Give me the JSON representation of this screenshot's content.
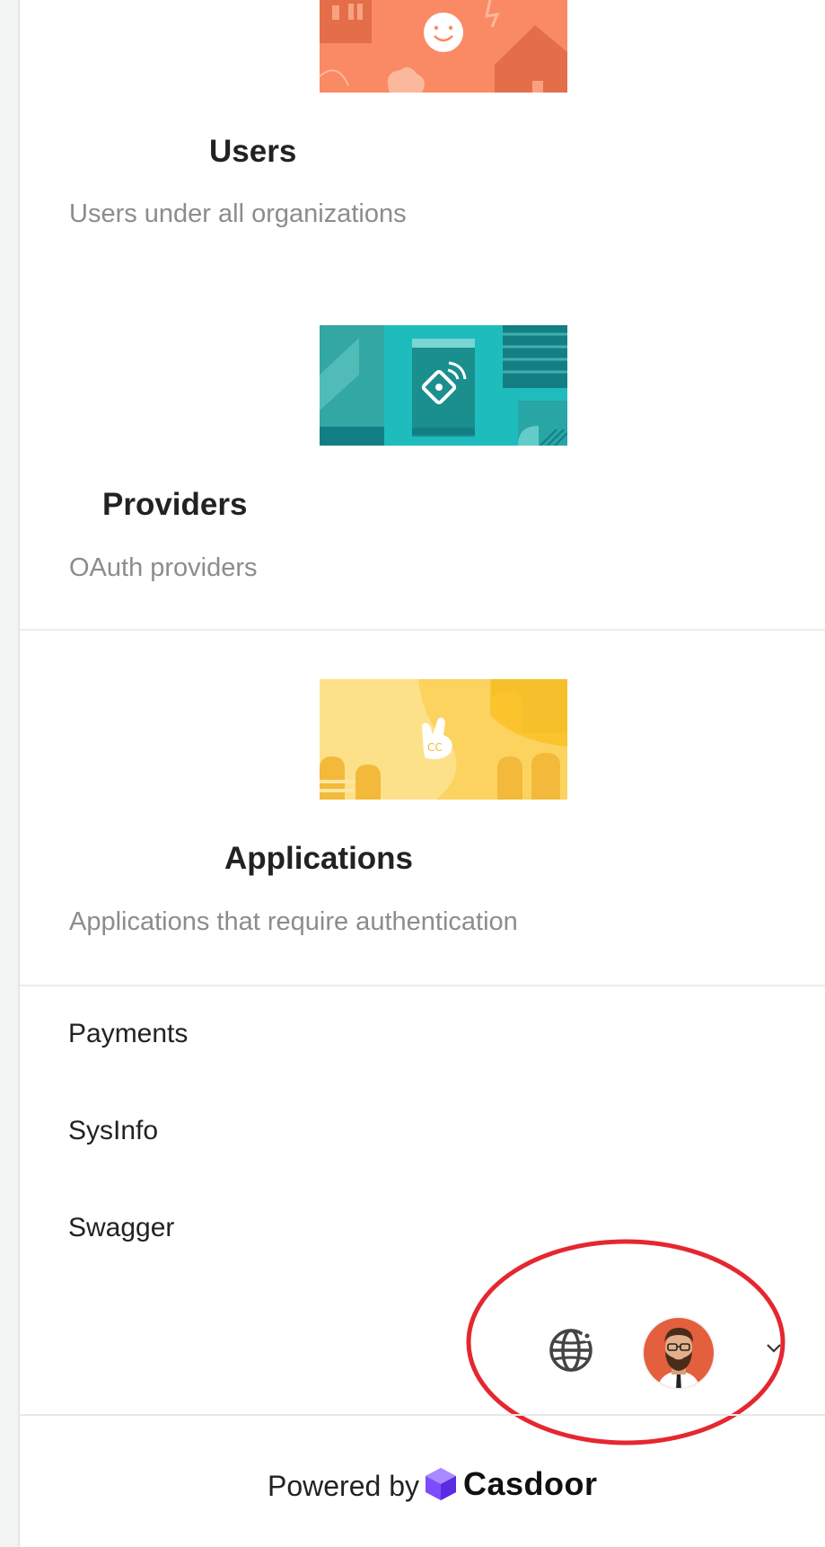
{
  "cards": [
    {
      "title": "Users",
      "description": "Users under all organizations"
    },
    {
      "title": "Providers",
      "description": "OAuth providers"
    },
    {
      "title": "Applications",
      "description": "Applications that require authentication"
    }
  ],
  "menu": {
    "items": [
      {
        "label": "Payments"
      },
      {
        "label": "SysInfo"
      },
      {
        "label": "Swagger"
      }
    ]
  },
  "toolbar": {
    "language_icon": "globe-icon",
    "avatar_icon": "user-avatar",
    "dropdown_icon": "chevron-down-icon"
  },
  "footer": {
    "powered_text": "Powered by",
    "brand_name": "Casdoor"
  },
  "colors": {
    "users_banner": "#f98a63",
    "providers_banner": "#1fbcbe",
    "applications_banner": "#fcd35f",
    "highlight_ellipse": "#e5272f",
    "brand_logo": "#7b4dff"
  }
}
